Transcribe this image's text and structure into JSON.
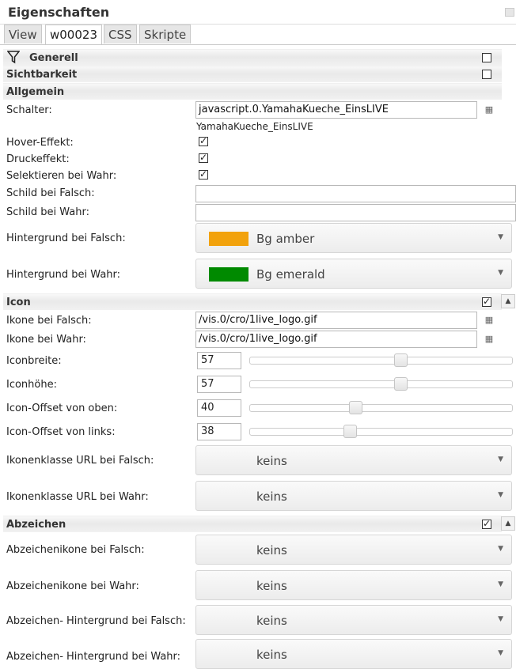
{
  "panel": {
    "title": "Eigenschaften"
  },
  "tabs": [
    {
      "label": "View",
      "active": false
    },
    {
      "label": "w00023",
      "active": true
    },
    {
      "label": "CSS",
      "active": false
    },
    {
      "label": "Skripte",
      "active": false
    }
  ],
  "groups": {
    "generell": {
      "label": "Generell",
      "checked": false
    },
    "sichtbarkeit": {
      "label": "Sichtbarkeit",
      "checked": false
    },
    "allgemein": {
      "label": "Allgemein"
    },
    "icon": {
      "label": "Icon",
      "checked": true
    },
    "abzeichen": {
      "label": "Abzeichen",
      "checked": true
    }
  },
  "allgemein": {
    "schalter_label": "Schalter:",
    "schalter_value": "javascript.0.YamahaKueche_EinsLIVE",
    "schalter_hint": "YamahaKueche_EinsLIVE",
    "hover_label": "Hover-Effekt:",
    "hover_checked": true,
    "druck_label": "Druckeffekt:",
    "druck_checked": true,
    "selektieren_label": "Selektieren bei Wahr:",
    "selektieren_checked": true,
    "schild_falsch_label": "Schild bei Falsch:",
    "schild_falsch_value": "",
    "schild_wahr_label": "Schild bei Wahr:",
    "schild_wahr_value": "",
    "bg_falsch_label": "Hintergrund bei Falsch:",
    "bg_falsch_value": "Bg amber",
    "bg_falsch_color": "#f2a20c",
    "bg_wahr_label": "Hintergrund bei Wahr:",
    "bg_wahr_value": "Bg emerald",
    "bg_wahr_color": "#008a00"
  },
  "icon": {
    "ikone_falsch_label": "Ikone bei Falsch:",
    "ikone_falsch_value": "/vis.0/cro/1live_logo.gif",
    "ikone_wahr_label": "Ikone bei Wahr:",
    "ikone_wahr_value": "/vis.0/cro/1live_logo.gif",
    "breite_label": "Iconbreite:",
    "breite_value": "57",
    "hoehe_label": "Iconhöhe:",
    "hoehe_value": "57",
    "offset_oben_label": "Icon-Offset von oben:",
    "offset_oben_value": "40",
    "offset_links_label": "Icon-Offset von links:",
    "offset_links_value": "38",
    "klasse_falsch_label": "Ikonenklasse URL bei Falsch:",
    "klasse_falsch_value": "keins",
    "klasse_wahr_label": "Ikonenklasse URL bei Wahr:",
    "klasse_wahr_value": "keins"
  },
  "abzeichen": {
    "ikone_falsch_label": "Abzeichenikone bei Falsch:",
    "ikone_falsch_value": "keins",
    "ikone_wahr_label": "Abzeichenikone bei Wahr:",
    "ikone_wahr_value": "keins",
    "bg_falsch_label": "Abzeichen- Hintergrund bei Falsch:",
    "bg_falsch_value": "keins",
    "bg_wahr_label": "Abzeichen- Hintergrund bei Wahr:",
    "bg_wahr_value": "keins"
  },
  "icons": {
    "filter": "filter-icon",
    "picker": "dots-picker-icon",
    "dropdown": "triangle-down-icon",
    "collapse": "triangle-up-icon"
  }
}
